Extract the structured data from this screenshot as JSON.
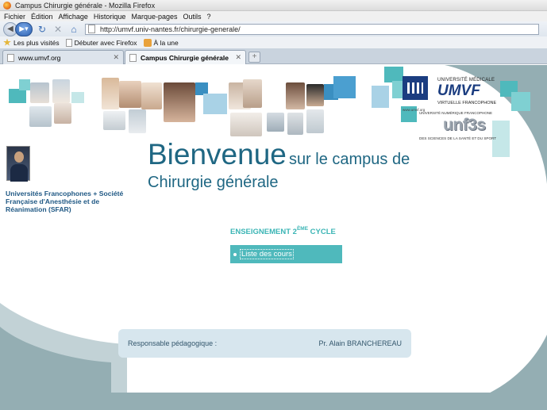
{
  "window": {
    "title": "Campus Chirurgie générale - Mozilla Firefox"
  },
  "menu": [
    "Fichier",
    "Édition",
    "Affichage",
    "Historique",
    "Marque-pages",
    "Outils",
    "?"
  ],
  "address": {
    "url": "http://umvf.univ-nantes.fr/chirurgie-generale/"
  },
  "bookmarks": [
    "Les plus visités",
    "Débuter avec Firefox",
    "À la une"
  ],
  "tabs": [
    {
      "label": "www.umvf.org",
      "active": false
    },
    {
      "label": "Campus Chirurgie générale",
      "active": true
    }
  ],
  "page": {
    "logo_umvf": {
      "line1": "UNIVERSITÉ MÉDICALE",
      "name": "UMVF",
      "line3": "VIRTUELLE FRANCOPHONE",
      "url": "www.umvf.org"
    },
    "logo_unf3s": {
      "line1": "UNIVERSITÉ NUMÉRIQUE FRANCOPHONE",
      "name": "unf3s",
      "line3": "DES SCIENCES DE LA SANTÉ ET DU SPORT"
    },
    "society": "Universités Francophones + Société Française d'Anesthésie et de Réanimation (SFAR)",
    "welcome_big": "Bienvenue",
    "welcome_rest": "sur le campus de",
    "welcome_line2": "Chirurgie générale",
    "section": {
      "prefix": "ENSEIGNEMENT 2",
      "sup": "ÈME",
      "suffix": "CYCLE"
    },
    "course_link": "Liste des cours",
    "responsable_label": "Responsable pédagogique :",
    "responsable_name": "Pr. Alain BRANCHEREAU"
  },
  "colors": {
    "teal": "#4fb9bc",
    "title_blue": "#1f6783",
    "background_grey": "#94aeb3"
  }
}
